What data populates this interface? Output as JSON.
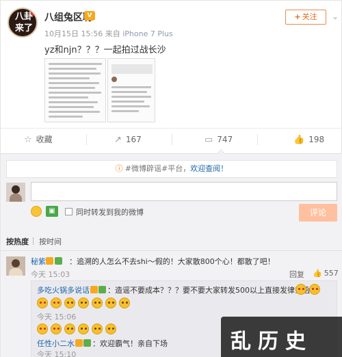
{
  "post": {
    "author": "八组兔区聘",
    "badge": "V",
    "avatar_line1": "八卦",
    "avatar_line2": "来了",
    "date": "10月15日 15:56",
    "source_prefix": "来自",
    "source": "iPhone 7 Plus",
    "text": "yz和njn？？？一起拍过战长沙",
    "follow_label": "关注",
    "more": "⌄"
  },
  "actions": {
    "favorite": "收藏",
    "repost": "167",
    "comment": "747",
    "like": "198"
  },
  "comments_panel": {
    "notice_tag": "#微博辟谣#",
    "notice_middle": "平台，",
    "notice_link": "欢迎查阅！",
    "checkbox_label": "同时转发到我的微博",
    "submit_label": "评论",
    "sort_hot": "按热度",
    "sort_time": "按时间"
  },
  "comments": [
    {
      "name": "秘紫",
      "text": "：追溯的人怎么不去shi～假的！大家散800个心！都散了吧！",
      "time": "今天 15:03",
      "reply_label": "回复",
      "likes": "557"
    }
  ],
  "replies": [
    {
      "name": "多吃火锅多说话",
      "text": "：造谣不要成本？？？要不要大家转发500以上直接发律师函",
      "time": "今天 15:06"
    },
    {
      "name": "任性小二水",
      "text": "：欢迎霸气！亲自下场",
      "time": "今天 15:10"
    }
  ],
  "watermark": "乱历史",
  "colors": {
    "link": "#1f65a6",
    "accent": "#e36c1a",
    "submit": "#ffc09f"
  }
}
